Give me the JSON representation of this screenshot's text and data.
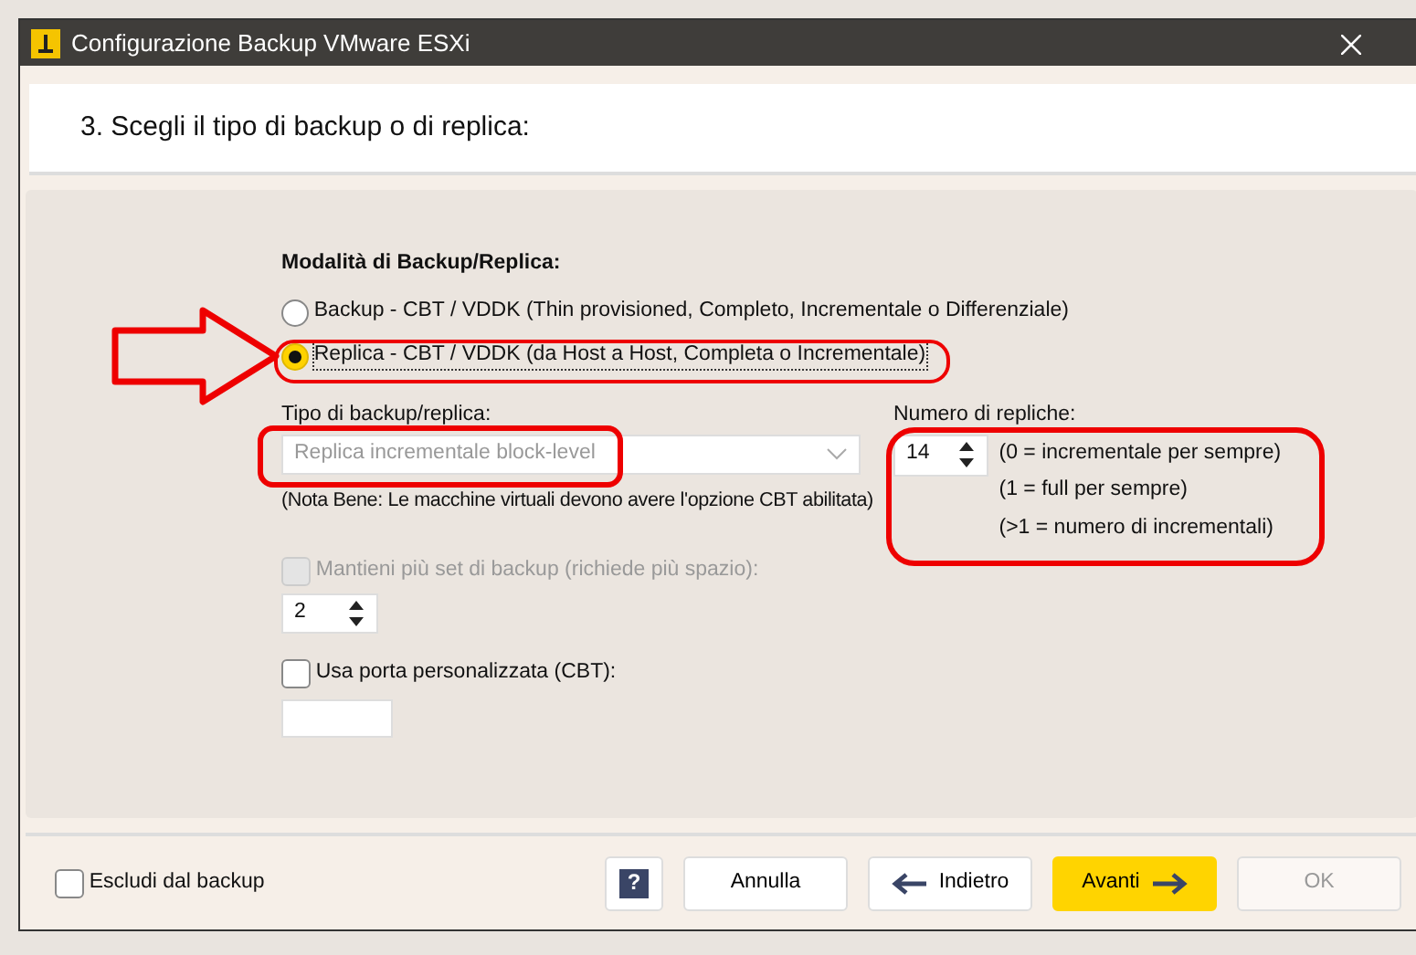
{
  "window": {
    "title": "Configurazione Backup VMware ESXi"
  },
  "header": {
    "step": "3. Scegli il tipo di backup o di replica:"
  },
  "mode": {
    "heading": "Modalità di Backup/Replica:",
    "options": [
      {
        "label": "Backup - CBT / VDDK (Thin provisioned, Completo, Incrementale o Differenziale)",
        "selected": false
      },
      {
        "label": "Replica - CBT / VDDK (da Host a Host, Completa o Incrementale)",
        "selected": true
      }
    ]
  },
  "type_field": {
    "label": "Tipo di backup/replica:",
    "value": "Replica incrementale block-level",
    "disabled": true
  },
  "note": "(Nota Bene: Le macchine virtuali devono avere l'opzione CBT abilitata)",
  "replicas": {
    "label": "Numero di repliche:",
    "value": "14",
    "hints": [
      "(0 = incrementale per sempre)",
      "(1 = full per sempre)",
      "(>1 = numero di incrementali)"
    ]
  },
  "keep_sets": {
    "label": "Mantieni più set di backup (richiede più spazio):",
    "checked": false,
    "disabled": true,
    "value": "2"
  },
  "custom_port": {
    "label": "Usa porta personalizzata (CBT):",
    "checked": false
  },
  "footer": {
    "exclude": {
      "label": "Escludi dal backup",
      "checked": false
    },
    "buttons": [
      {
        "kind": "help",
        "label": "?"
      },
      {
        "kind": "plain",
        "label": "Annulla",
        "disabled": false
      },
      {
        "kind": "back",
        "label": "Indietro",
        "disabled": false
      },
      {
        "kind": "next",
        "label": "Avanti",
        "disabled": false
      },
      {
        "kind": "plain",
        "label": "OK",
        "disabled": true
      }
    ]
  }
}
